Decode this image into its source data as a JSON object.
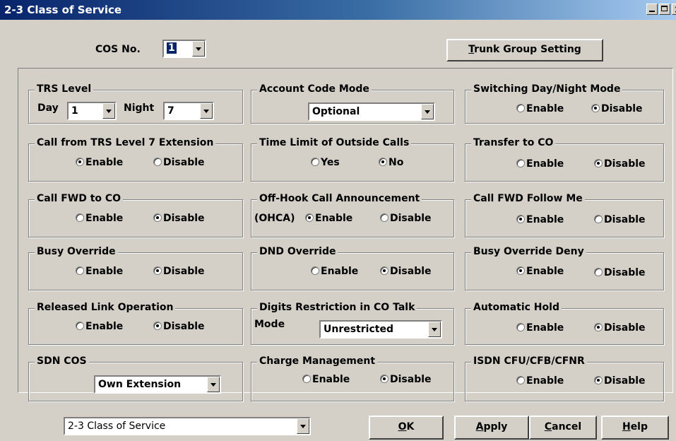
{
  "window": {
    "title": "2-3 Class of Service"
  },
  "cos": {
    "label": "COS No.",
    "value": "1"
  },
  "trunk_button": {
    "label_u": "T",
    "label_rest": "runk Group Setting"
  },
  "trs_level": {
    "legend": "TRS Level",
    "day_label": "Day",
    "day_value": "1",
    "night_label": "Night",
    "night_value": "7"
  },
  "account_code": {
    "legend": "Account Code Mode",
    "value": "Optional"
  },
  "switching_day_night": {
    "legend": "Switching Day/Night Mode",
    "enable": "Enable",
    "disable": "Disable",
    "selected": "disable"
  },
  "call_from_trs7": {
    "legend": "Call from TRS Level 7 Extension",
    "enable": "Enable",
    "disable": "Disable",
    "selected": "enable"
  },
  "time_limit": {
    "legend": "Time Limit of Outside Calls",
    "yes": "Yes",
    "no": "No",
    "selected": "no"
  },
  "transfer_co": {
    "legend": "Transfer to CO",
    "enable": "Enable",
    "disable": "Disable",
    "selected": "disable"
  },
  "call_fwd_co": {
    "legend": "Call FWD to CO",
    "enable": "Enable",
    "disable": "Disable",
    "selected": "disable"
  },
  "ohca": {
    "legend": "Off-Hook Call Announcement",
    "prefix": "(OHCA)",
    "enable": "Enable",
    "disable": "Disable",
    "selected": "enable"
  },
  "call_fwd_follow": {
    "legend": "Call FWD Follow Me",
    "enable": "Enable",
    "disable": "Disable",
    "selected": "enable"
  },
  "busy_override": {
    "legend": "Busy Override",
    "enable": "Enable",
    "disable": "Disable",
    "selected": "disable"
  },
  "dnd_override": {
    "legend": "DND Override",
    "enable": "Enable",
    "disable": "Disable",
    "selected": "disable"
  },
  "busy_override_deny": {
    "legend": "Busy Override Deny",
    "enable": "Enable",
    "disable": "Disable",
    "selected": "enable"
  },
  "released_link": {
    "legend": "Released Link Operation",
    "enable": "Enable",
    "disable": "Disable",
    "selected": "disable"
  },
  "digits_restriction": {
    "legend": "Digits Restriction in CO Talk",
    "mode_label": "Mode",
    "value": "Unrestricted"
  },
  "automatic_hold": {
    "legend": "Automatic Hold",
    "enable": "Enable",
    "disable": "Disable",
    "selected": "disable"
  },
  "sdn_cos": {
    "legend": "SDN COS",
    "value": "Own Extension"
  },
  "charge_mgmt": {
    "legend": "Charge Management",
    "enable": "Enable",
    "disable": "Disable",
    "selected": "disable"
  },
  "isdn_cfu": {
    "legend": "ISDN CFU/CFB/CFNR",
    "enable": "Enable",
    "disable": "Disable",
    "selected": "disable"
  },
  "footer": {
    "nav_value": "2-3 Class of Service",
    "ok_u": "O",
    "ok_rest": "K",
    "apply_u": "A",
    "apply_rest": "pply",
    "cancel_u": "C",
    "cancel_rest": "ancel",
    "help_u": "H",
    "help_rest": "elp"
  }
}
